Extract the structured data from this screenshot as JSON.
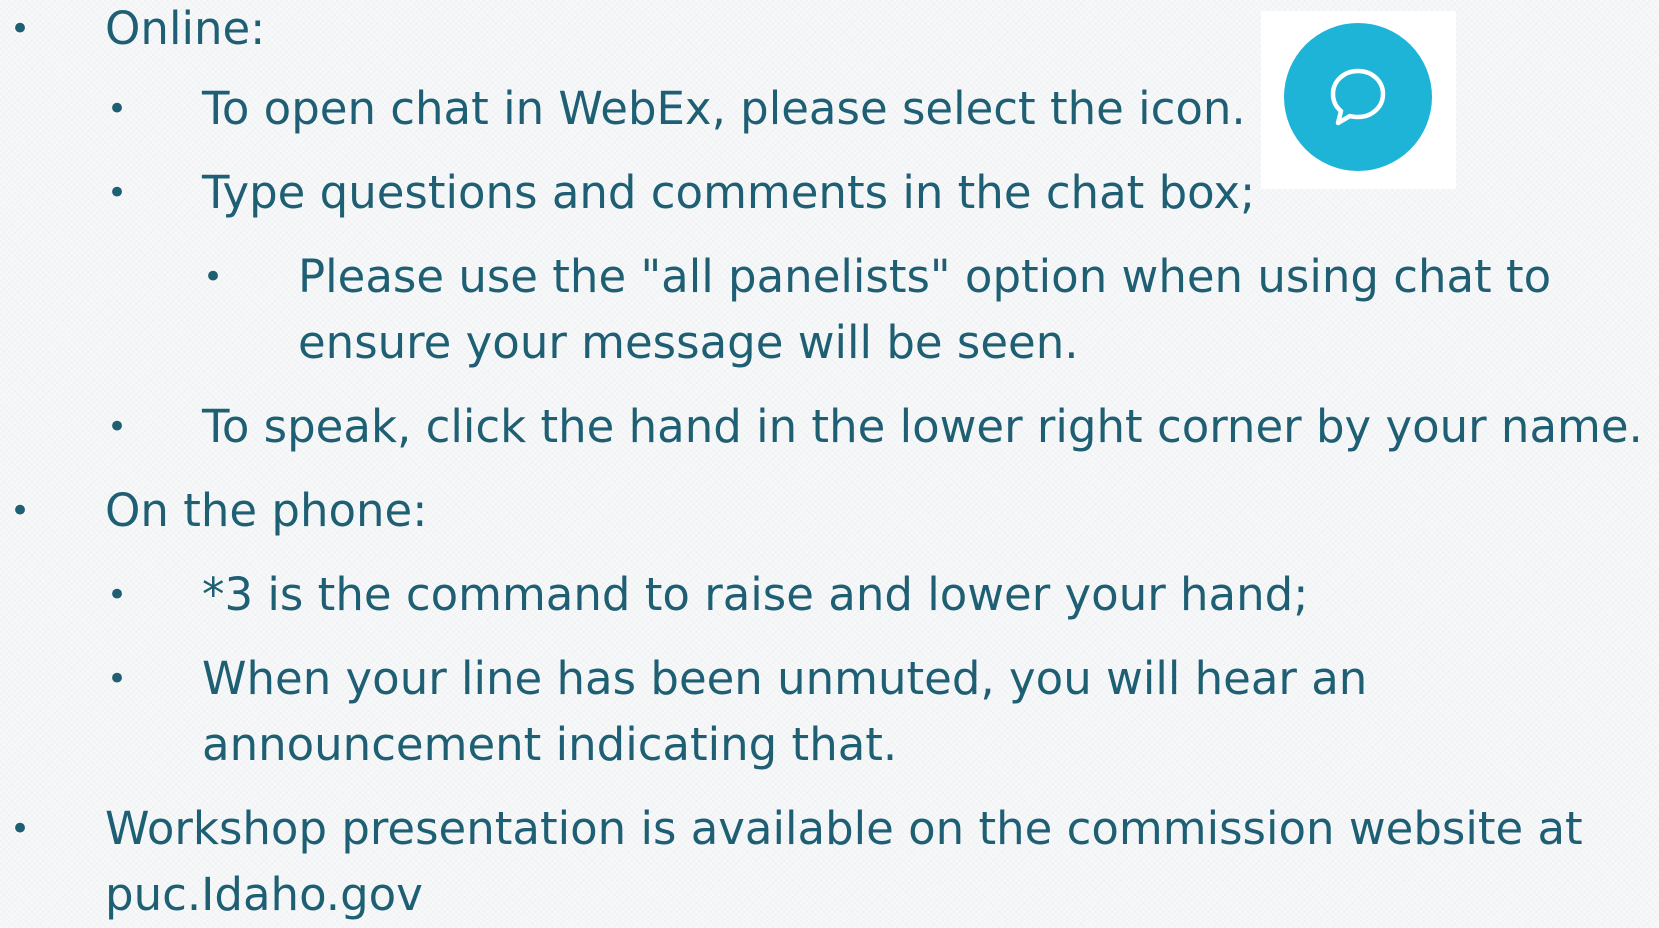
{
  "bullets": {
    "online": "Online:",
    "online_open_chat": "To open chat in WebEx, please select the icon.",
    "online_type_questions": "Type questions and comments in the chat box;",
    "online_all_panelists_line1": "Please use the \"all panelists\" option when using chat to",
    "online_all_panelists_line2": "ensure your message will be seen.",
    "online_speak": "To speak, click the hand in the lower right corner by your name.",
    "phone": "On the phone:",
    "phone_raise_hand": "*3 is the command to raise and lower your hand;",
    "phone_unmuted_line1": "When your line has been unmuted, you will hear an",
    "phone_unmuted_line2": "announcement indicating that.",
    "workshop_line1": "Workshop presentation is available on the commission website at",
    "workshop_line2": "puc.Idaho.gov"
  },
  "bullet_symbol": "•",
  "icon": {
    "name": "chat-bubble-icon",
    "color": "#1eb4d8"
  },
  "text_color": "#1e5f74"
}
